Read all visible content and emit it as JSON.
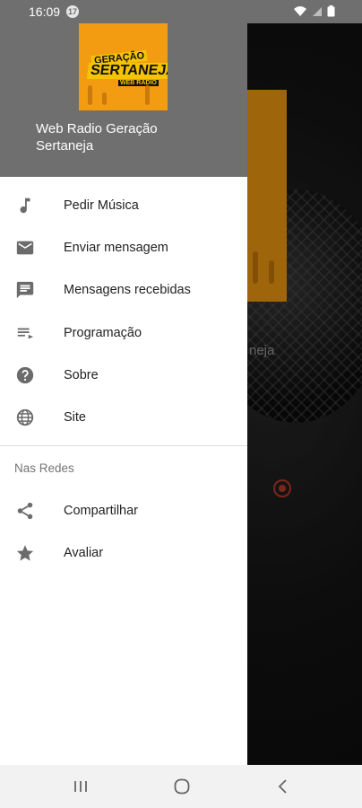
{
  "status_bar": {
    "time": "16:09",
    "notification_count": "17"
  },
  "background_app": {
    "partial_title": "neja"
  },
  "drawer": {
    "title": "Web Radio Geração Sertaneja",
    "logo_text": [
      "GERAÇÃO",
      "SERTANEJA",
      "WEB RÁDIO"
    ],
    "items": [
      {
        "label": "Pedir Música",
        "icon": "music-note-icon"
      },
      {
        "label": "Enviar mensagem",
        "icon": "mail-icon"
      },
      {
        "label": "Mensagens recebidas",
        "icon": "chat-icon"
      },
      {
        "label": "Programação",
        "icon": "playlist-icon"
      },
      {
        "label": "Sobre",
        "icon": "help-icon"
      },
      {
        "label": "Site",
        "icon": "globe-icon"
      }
    ],
    "section_title": "Nas Redes",
    "social_items": [
      {
        "label": "Compartilhar",
        "icon": "share-icon"
      },
      {
        "label": "Avaliar",
        "icon": "star-icon"
      }
    ]
  },
  "colors": {
    "header": "#6f6f6f",
    "icon": "#6b6b6b",
    "logo_orange": "#f39c12",
    "logo_yellow": "#f5c400",
    "accent_red": "#c0392b"
  }
}
